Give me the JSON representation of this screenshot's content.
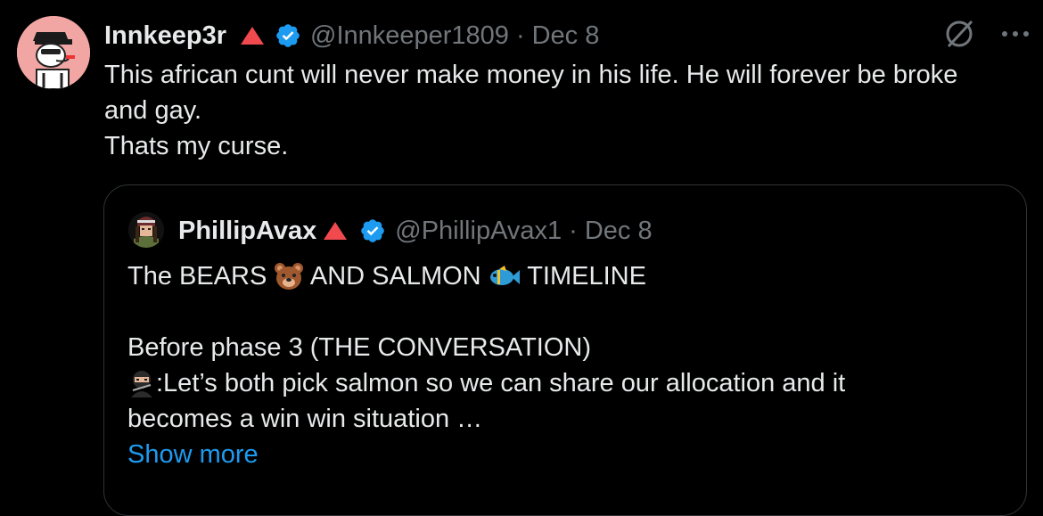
{
  "tweet": {
    "author_name": "Innkeep3r",
    "handle": "@Innkeeper1809",
    "separator": "·",
    "date": "Dec 8",
    "text_lines": [
      "This african cunt will never make money in his life. He will forever be broke",
      "and gay.",
      "Thats my curse."
    ]
  },
  "icons": {
    "red_triangle": "red-triangle-icon",
    "verified": "verified-badge-icon",
    "grok": "grok-icon",
    "more": "more-icon",
    "bear": "bear-face-emoji",
    "fish": "tropical-fish-emoji",
    "ninja": "ninja-emoji"
  },
  "quote": {
    "author_name": "PhillipAvax",
    "handle": "@PhillipAvax1",
    "separator": "·",
    "date": "Dec 8",
    "line1_a": "The BEARS ",
    "line1_b": " AND SALMON ",
    "line1_c": " TIMELINE",
    "line3": "Before phase 3 (THE CONVERSATION)",
    "line4": ":Let’s both pick salmon so we can share our allocation and it",
    "line5": "becomes a win win situation …",
    "show_more": "Show more"
  },
  "colors": {
    "background": "#000000",
    "text": "#e7e9ea",
    "muted": "#71767b",
    "link": "#1d9bf0",
    "triangle": "#f04a4f",
    "verified": "#1d9bf0",
    "border": "#2f3336"
  }
}
